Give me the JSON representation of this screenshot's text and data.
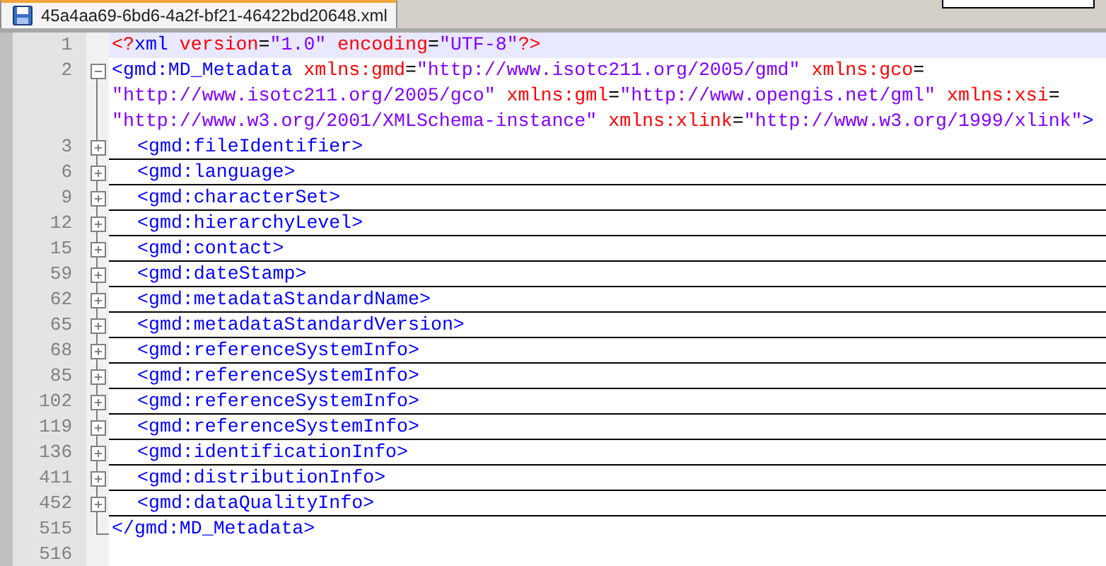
{
  "tab": {
    "label": "45a4aa69-6bd6-4a2f-bf21-46422bd20648.xml",
    "selected": true
  },
  "lines": [
    {
      "number": "1",
      "current": true,
      "wrapped_lines": [
        {
          "tokens": [
            {
              "kind": "pi",
              "text": "<?"
            },
            {
              "kind": "tag",
              "text": "xml"
            },
            {
              "kind": "attr",
              "text": " version"
            },
            {
              "kind": "eq",
              "text": "="
            },
            {
              "kind": "value",
              "text": "\"1.0\""
            },
            {
              "kind": "attr",
              "text": " encoding"
            },
            {
              "kind": "eq",
              "text": "="
            },
            {
              "kind": "value",
              "text": "\"UTF-8\""
            },
            {
              "kind": "pi",
              "text": "?>"
            }
          ]
        }
      ]
    },
    {
      "number": "2",
      "current": false,
      "expanded": true,
      "wrapped_lines": [
        {
          "tokens": [
            {
              "kind": "tag",
              "text": "<gmd:MD_Metadata"
            },
            {
              "kind": "attr",
              "text": " xmlns:gmd"
            },
            {
              "kind": "eq",
              "text": "="
            },
            {
              "kind": "value",
              "text": "\"http://www.isotc211.org/2005/gmd\""
            },
            {
              "kind": "attr",
              "text": " xmlns:gco"
            },
            {
              "kind": "eq",
              "text": "="
            }
          ]
        },
        {
          "tokens": [
            {
              "kind": "value",
              "text": "\"http://www.isotc211.org/2005/gco\""
            },
            {
              "kind": "attr",
              "text": " xmlns:gml"
            },
            {
              "kind": "eq",
              "text": "="
            },
            {
              "kind": "value",
              "text": "\"http://www.opengis.net/gml\""
            },
            {
              "kind": "attr",
              "text": " xmlns:xsi"
            },
            {
              "kind": "eq",
              "text": "="
            }
          ]
        },
        {
          "tokens": [
            {
              "kind": "value",
              "text": "\"http://www.w3.org/2001/XMLSchema-instance\""
            },
            {
              "kind": "attr",
              "text": " xmlns:xlink"
            },
            {
              "kind": "eq",
              "text": "="
            },
            {
              "kind": "value",
              "text": "\"http://www.w3.org/1999/xlink\""
            },
            {
              "kind": "tag",
              "text": ">"
            }
          ]
        }
      ],
      "children": [
        {
          "number": "3",
          "expanded": false,
          "text": "<gmd:fileIdentifier>"
        },
        {
          "number": "6",
          "expanded": false,
          "text": "<gmd:language>"
        },
        {
          "number": "9",
          "expanded": false,
          "text": "<gmd:characterSet>"
        },
        {
          "number": "12",
          "expanded": false,
          "text": "<gmd:hierarchyLevel>"
        },
        {
          "number": "15",
          "expanded": false,
          "text": "<gmd:contact>"
        },
        {
          "number": "59",
          "expanded": false,
          "text": "<gmd:dateStamp>"
        },
        {
          "number": "62",
          "expanded": false,
          "text": "<gmd:metadataStandardName>"
        },
        {
          "number": "65",
          "expanded": false,
          "text": "<gmd:metadataStandardVersion>"
        },
        {
          "number": "68",
          "expanded": false,
          "text": "<gmd:referenceSystemInfo>"
        },
        {
          "number": "85",
          "expanded": false,
          "text": "<gmd:referenceSystemInfo>"
        },
        {
          "number": "102",
          "expanded": false,
          "text": "<gmd:referenceSystemInfo>"
        },
        {
          "number": "119",
          "expanded": false,
          "text": "<gmd:referenceSystemInfo>"
        },
        {
          "number": "136",
          "expanded": false,
          "text": "<gmd:identificationInfo>"
        },
        {
          "number": "411",
          "expanded": false,
          "text": "<gmd:distributionInfo>"
        },
        {
          "number": "452",
          "expanded": false,
          "text": "<gmd:dataQualityInfo>"
        }
      ],
      "closing": {
        "number": "515",
        "text": "</gmd:MD_Metadata>"
      }
    },
    {
      "number": "516",
      "current": false
    }
  ]
}
